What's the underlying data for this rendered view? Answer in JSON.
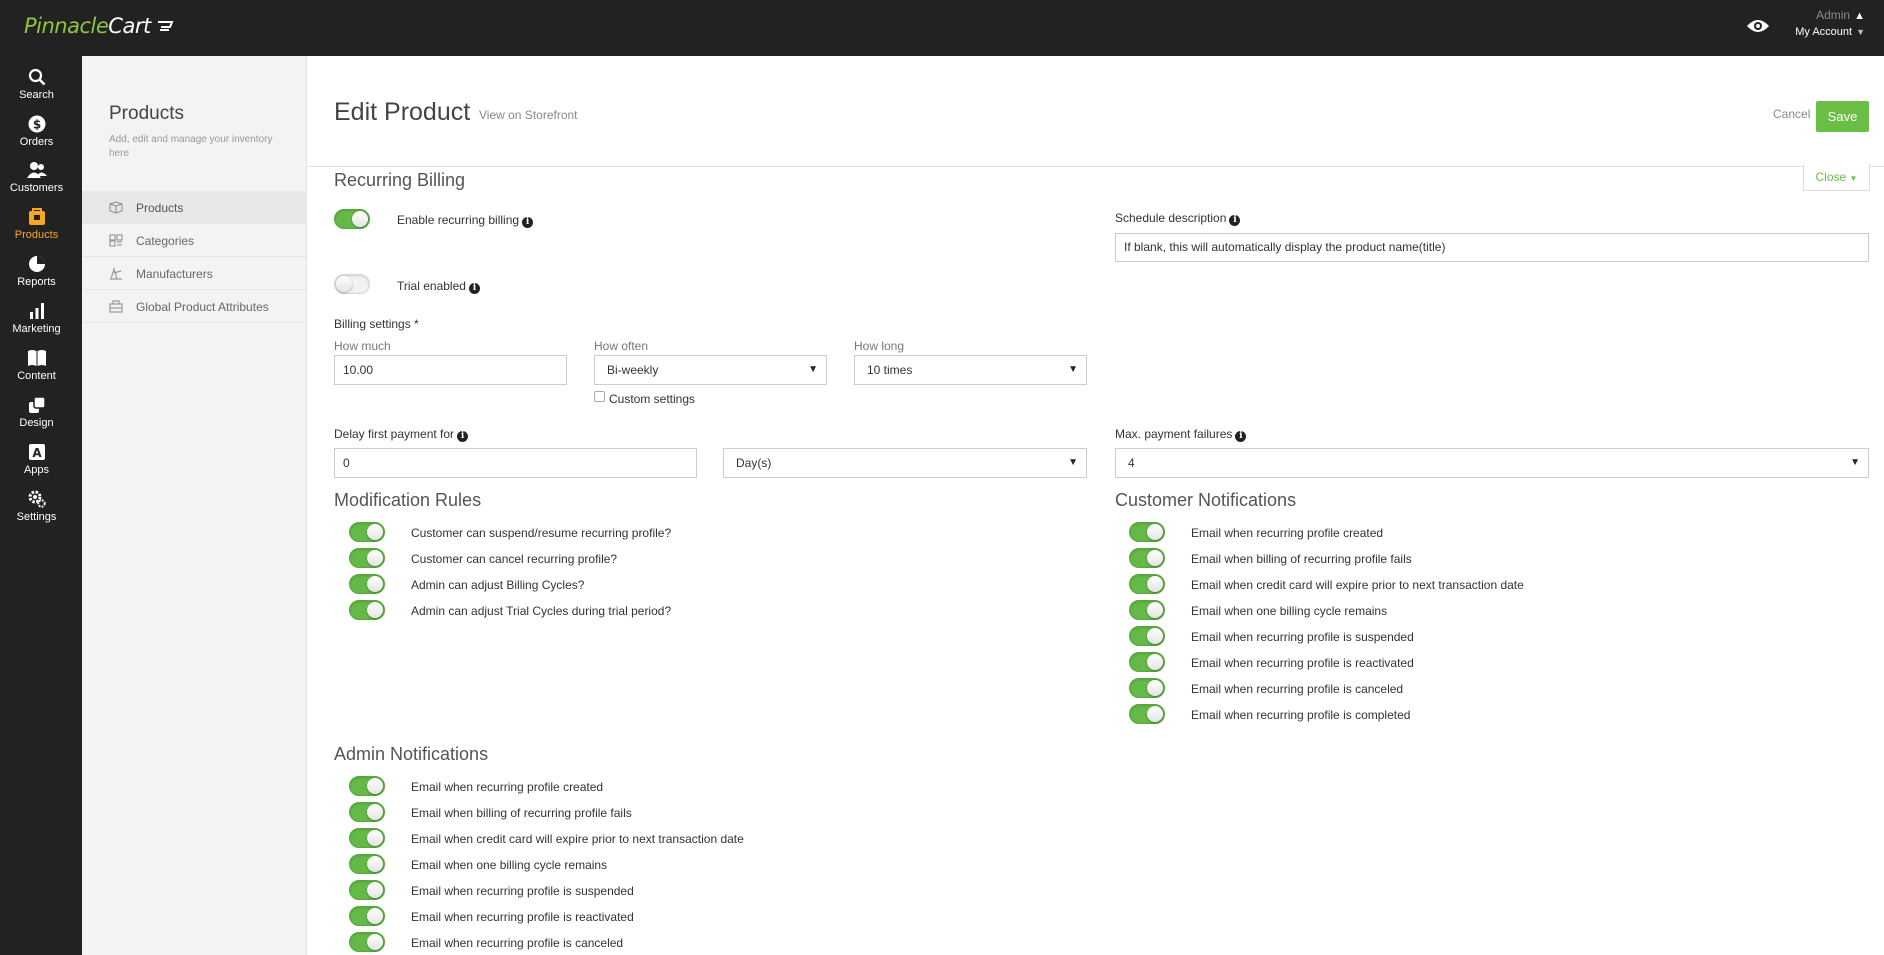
{
  "brand": {
    "name_part1": "Pinnacle",
    "name_part2": "Cart",
    "accent": "#8dc63f"
  },
  "topbar": {
    "admin_label": "Admin",
    "my_account_label": "My Account"
  },
  "rail": {
    "items": [
      {
        "label": "Search",
        "icon": "search-icon"
      },
      {
        "label": "Orders",
        "icon": "dollar-icon"
      },
      {
        "label": "Customers",
        "icon": "customers-icon"
      },
      {
        "label": "Products",
        "icon": "products-icon",
        "active": true
      },
      {
        "label": "Reports",
        "icon": "pie-chart-icon"
      },
      {
        "label": "Marketing",
        "icon": "bar-chart-icon"
      },
      {
        "label": "Content",
        "icon": "book-icon"
      },
      {
        "label": "Design",
        "icon": "design-icon"
      },
      {
        "label": "Apps",
        "icon": "apps-icon"
      },
      {
        "label": "Settings",
        "icon": "gear-icon"
      }
    ]
  },
  "subnav": {
    "title": "Products",
    "description": "Add, edit and manage your inventory here",
    "items": [
      {
        "label": "Products",
        "icon": "box-icon",
        "active": true
      },
      {
        "label": "Categories",
        "icon": "categories-icon"
      },
      {
        "label": "Manufacturers",
        "icon": "manufacturer-icon"
      },
      {
        "label": "Global Product Attributes",
        "icon": "attributes-icon"
      }
    ]
  },
  "header": {
    "title": "Edit Product",
    "view_link": "View on Storefront",
    "cancel_label": "Cancel",
    "save_label": "Save"
  },
  "recurring": {
    "section_title": "Recurring Billing",
    "close_label": "Close",
    "enable_label": "Enable recurring billing",
    "enable_on": true,
    "trial_label": "Trial enabled",
    "trial_on": false,
    "schedule_label": "Schedule description",
    "schedule_value": "If blank, this will automatically display the product name(title)",
    "billing_settings_label": "Billing settings *",
    "how_much_label": "How much",
    "how_much_value": "10.00",
    "how_often_label": "How often",
    "how_often_value": "Bi-weekly",
    "custom_settings_label": "Custom settings",
    "how_long_label": "How long",
    "how_long_value": "10 times",
    "delay_label": "Delay first payment for",
    "delay_value": "0",
    "delay_unit": "Day(s)",
    "max_failures_label": "Max. payment failures",
    "max_failures_value": "4"
  },
  "modification_rules": {
    "title": "Modification Rules",
    "items": [
      "Customer can suspend/resume recurring profile?",
      "Customer can cancel recurring profile?",
      "Admin can adjust Billing Cycles?",
      "Admin can adjust Trial Cycles during trial period?"
    ]
  },
  "customer_notifications": {
    "title": "Customer Notifications",
    "items": [
      "Email when recurring profile created",
      "Email when billing of recurring profile fails",
      "Email when credit card will expire prior to next transaction date",
      "Email when one billing cycle remains",
      "Email when recurring profile is suspended",
      "Email when recurring profile is reactivated",
      "Email when recurring profile is canceled",
      "Email when recurring profile is completed"
    ]
  },
  "admin_notifications": {
    "title": "Admin Notifications",
    "items": [
      "Email when recurring profile created",
      "Email when billing of recurring profile fails",
      "Email when credit card will expire prior to next transaction date",
      "Email when one billing cycle remains",
      "Email when recurring profile is suspended",
      "Email when recurring profile is reactivated",
      "Email when recurring profile is canceled"
    ]
  }
}
